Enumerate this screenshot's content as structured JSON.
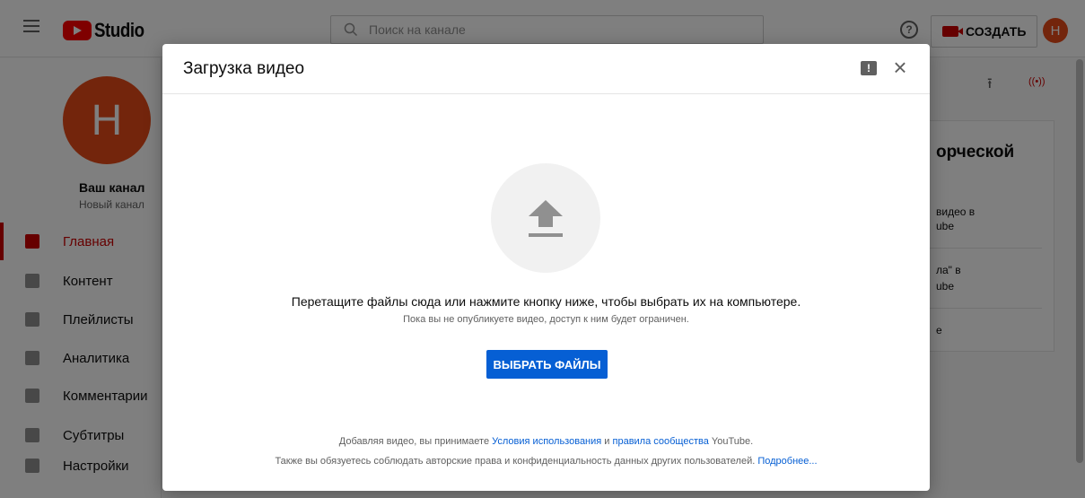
{
  "app": {
    "logo_text": "Studio",
    "search_placeholder": "Поиск на канале",
    "help_label": "?",
    "create_label": "СОЗДАТЬ",
    "avatar_letter": "Н"
  },
  "sidebar": {
    "avatar_letter": "Н",
    "channel_name": "Ваш канал",
    "channel_sub": "Новый канал",
    "items": [
      {
        "label": "Главная",
        "active": true
      },
      {
        "label": "Контент"
      },
      {
        "label": "Плейлисты"
      },
      {
        "label": "Аналитика"
      },
      {
        "label": "Комментарии"
      },
      {
        "label": "Субтитры"
      },
      {
        "label": "Настройки"
      }
    ]
  },
  "right_panel": {
    "title": "орческой",
    "line1a": "видео в",
    "line1b": "ube",
    "line2a": "ла\" в",
    "line2b": "ube",
    "line3": "е"
  },
  "dialog": {
    "title": "Загрузка видео",
    "feedback_glyph": "!",
    "close_glyph": "×",
    "main_text": "Перетащите файлы сюда или нажмите кнопку ниже, чтобы выбрать их на компьютере.",
    "sub_text": "Пока вы не опубликуете видео, доступ к ним будет ограничен.",
    "select_button": "ВЫБРАТЬ ФАЙЛЫ",
    "footer1_prefix": "Добавляя видео, вы принимаете ",
    "footer1_link1": "Условия использования",
    "footer1_and": " и ",
    "footer1_link2": "правила сообщества",
    "footer1_suffix": " YouTube.",
    "footer2_text": "Также вы обязуетесь соблюдать авторские права и конфиденциальность данных других пользователей. ",
    "footer2_link": "Подробнее..."
  }
}
